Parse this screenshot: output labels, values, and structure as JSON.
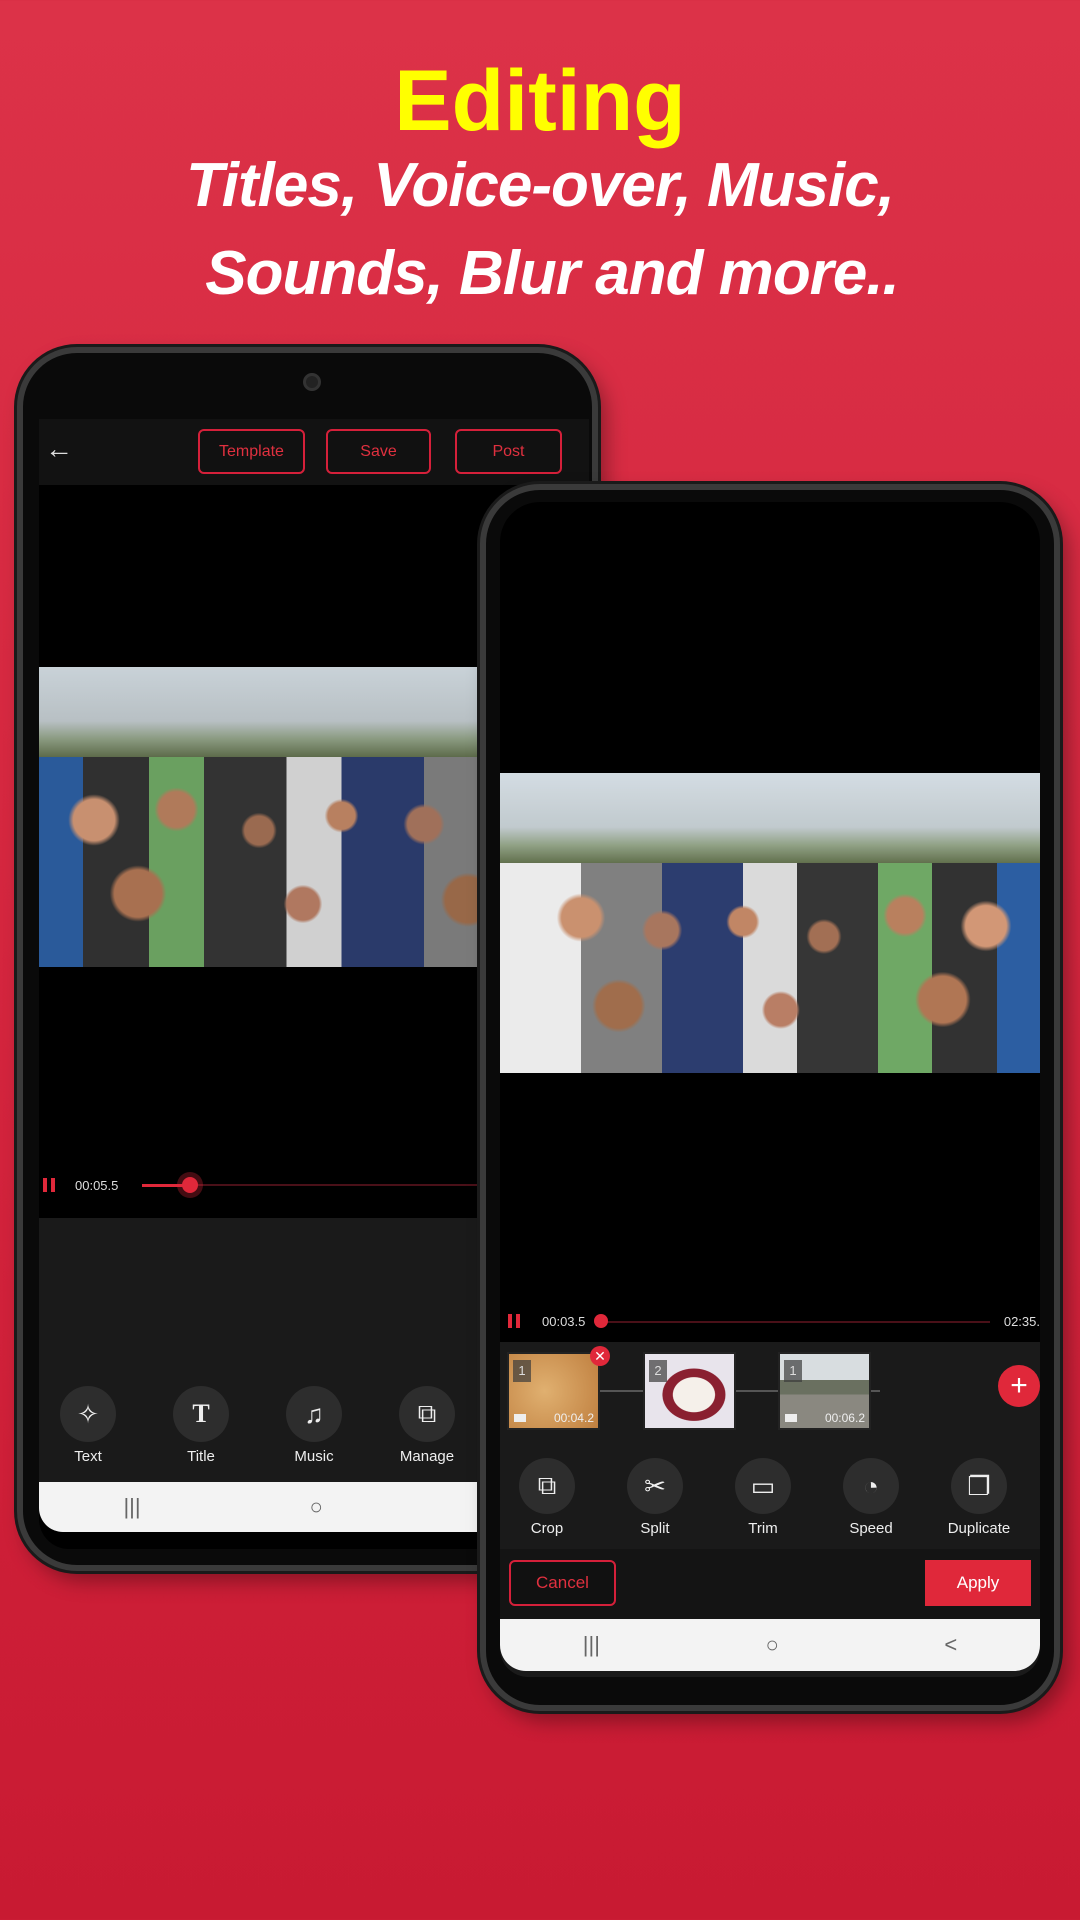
{
  "hero": {
    "title": "Editing",
    "subtitle_line1": "Titles, Voice-over, Music,",
    "subtitle_line2": "Sounds, Blur and more.."
  },
  "colors": {
    "background": "#dc3248",
    "accent": "#e0283a",
    "title": "#ffff00"
  },
  "left_phone": {
    "header": {
      "back_icon": "arrow-left-icon",
      "buttons": [
        "Template",
        "Save",
        "Post"
      ]
    },
    "player": {
      "current_time": "00:05.5",
      "progress": 0.1
    },
    "tools": [
      {
        "label": "Text",
        "icon": "text-sparkle-icon"
      },
      {
        "label": "Title",
        "icon": "title-t-icon"
      },
      {
        "label": "Music",
        "icon": "music-note-icon"
      },
      {
        "label": "Manage",
        "icon": "crop-icon"
      }
    ]
  },
  "right_phone": {
    "player": {
      "current_time": "00:03.5",
      "total_time": "02:35.",
      "progress": 0.03
    },
    "clips": [
      {
        "number": "1",
        "duration": "00:04.2",
        "selected": true
      },
      {
        "number": "2",
        "duration": ""
      },
      {
        "number": "1",
        "duration": "00:06.2"
      }
    ],
    "tools": [
      {
        "label": "Crop",
        "icon": "crop-icon"
      },
      {
        "label": "Split",
        "icon": "split-icon"
      },
      {
        "label": "Trim",
        "icon": "trim-icon"
      },
      {
        "label": "Speed",
        "icon": "speedometer-icon"
      },
      {
        "label": "Duplicate",
        "icon": "duplicate-icon"
      }
    ],
    "cancel_label": "Cancel",
    "apply_label": "Apply"
  },
  "navbar": {
    "recents": "|||",
    "home": "○",
    "back": "<"
  }
}
